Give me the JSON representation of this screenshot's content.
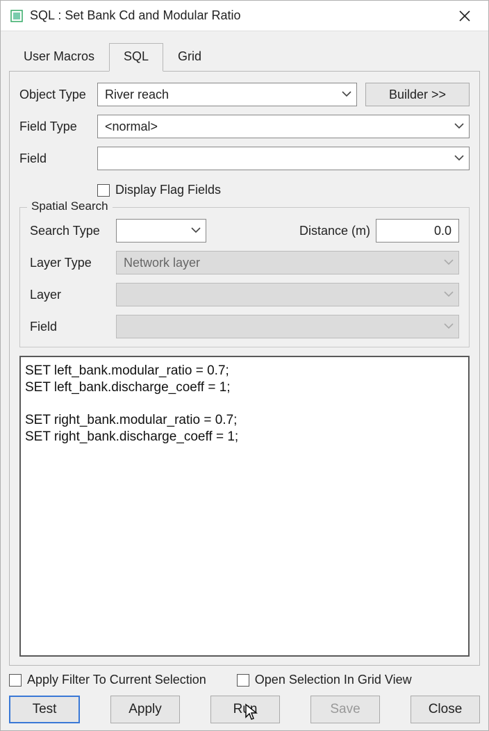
{
  "window": {
    "title": "SQL : Set Bank Cd and Modular Ratio"
  },
  "tabs": {
    "user_macros": "User Macros",
    "sql": "SQL",
    "grid": "Grid"
  },
  "fields": {
    "object_type_label": "Object Type",
    "object_type_value": "River reach",
    "builder_btn": "Builder >>",
    "field_type_label": "Field Type",
    "field_type_value": "<normal>",
    "field_label": "Field",
    "field_value": "",
    "display_flag_label": "Display Flag Fields"
  },
  "spatial": {
    "legend": "Spatial Search",
    "search_type_label": "Search Type",
    "search_type_value": "",
    "distance_label": "Distance (m)",
    "distance_value": "0.0",
    "layer_type_label": "Layer Type",
    "layer_type_value": "Network layer",
    "layer_label": "Layer",
    "layer_value": "",
    "field_label": "Field",
    "field_value": ""
  },
  "sql_text": "SET left_bank.modular_ratio = 0.7;\nSET left_bank.discharge_coeff = 1;\n\nSET right_bank.modular_ratio = 0.7;\nSET right_bank.discharge_coeff = 1;",
  "bottom": {
    "apply_filter_label": "Apply Filter To Current Selection",
    "open_grid_label": "Open Selection In Grid View"
  },
  "buttons": {
    "test": "Test",
    "apply": "Apply",
    "run": "Run",
    "save": "Save",
    "close": "Close"
  }
}
